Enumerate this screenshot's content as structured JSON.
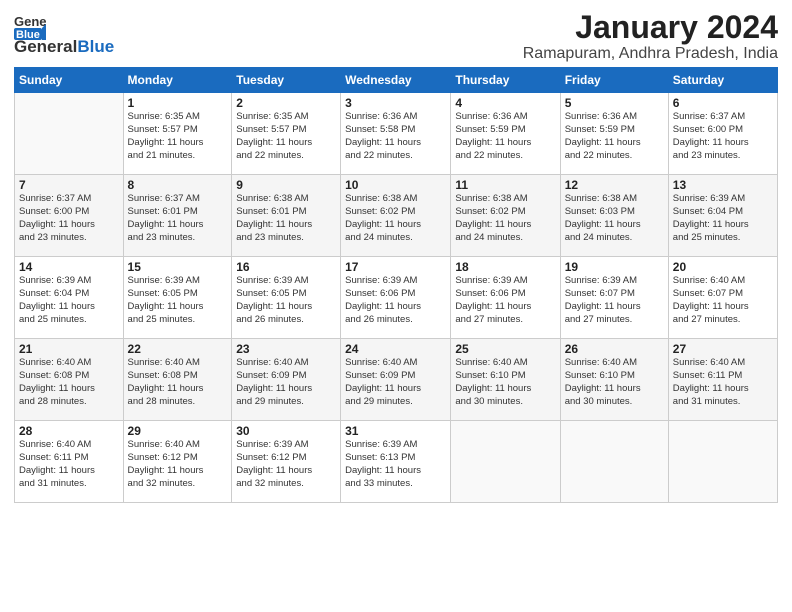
{
  "header": {
    "logo_general": "General",
    "logo_blue": "Blue",
    "month_title": "January 2024",
    "location": "Ramapuram, Andhra Pradesh, India"
  },
  "days_of_week": [
    "Sunday",
    "Monday",
    "Tuesday",
    "Wednesday",
    "Thursday",
    "Friday",
    "Saturday"
  ],
  "weeks": [
    [
      {
        "day": "",
        "info": ""
      },
      {
        "day": "1",
        "info": "Sunrise: 6:35 AM\nSunset: 5:57 PM\nDaylight: 11 hours\nand 21 minutes."
      },
      {
        "day": "2",
        "info": "Sunrise: 6:35 AM\nSunset: 5:57 PM\nDaylight: 11 hours\nand 22 minutes."
      },
      {
        "day": "3",
        "info": "Sunrise: 6:36 AM\nSunset: 5:58 PM\nDaylight: 11 hours\nand 22 minutes."
      },
      {
        "day": "4",
        "info": "Sunrise: 6:36 AM\nSunset: 5:59 PM\nDaylight: 11 hours\nand 22 minutes."
      },
      {
        "day": "5",
        "info": "Sunrise: 6:36 AM\nSunset: 5:59 PM\nDaylight: 11 hours\nand 22 minutes."
      },
      {
        "day": "6",
        "info": "Sunrise: 6:37 AM\nSunset: 6:00 PM\nDaylight: 11 hours\nand 23 minutes."
      }
    ],
    [
      {
        "day": "7",
        "info": "Sunrise: 6:37 AM\nSunset: 6:00 PM\nDaylight: 11 hours\nand 23 minutes."
      },
      {
        "day": "8",
        "info": "Sunrise: 6:37 AM\nSunset: 6:01 PM\nDaylight: 11 hours\nand 23 minutes."
      },
      {
        "day": "9",
        "info": "Sunrise: 6:38 AM\nSunset: 6:01 PM\nDaylight: 11 hours\nand 23 minutes."
      },
      {
        "day": "10",
        "info": "Sunrise: 6:38 AM\nSunset: 6:02 PM\nDaylight: 11 hours\nand 24 minutes."
      },
      {
        "day": "11",
        "info": "Sunrise: 6:38 AM\nSunset: 6:02 PM\nDaylight: 11 hours\nand 24 minutes."
      },
      {
        "day": "12",
        "info": "Sunrise: 6:38 AM\nSunset: 6:03 PM\nDaylight: 11 hours\nand 24 minutes."
      },
      {
        "day": "13",
        "info": "Sunrise: 6:39 AM\nSunset: 6:04 PM\nDaylight: 11 hours\nand 25 minutes."
      }
    ],
    [
      {
        "day": "14",
        "info": "Sunrise: 6:39 AM\nSunset: 6:04 PM\nDaylight: 11 hours\nand 25 minutes."
      },
      {
        "day": "15",
        "info": "Sunrise: 6:39 AM\nSunset: 6:05 PM\nDaylight: 11 hours\nand 25 minutes."
      },
      {
        "day": "16",
        "info": "Sunrise: 6:39 AM\nSunset: 6:05 PM\nDaylight: 11 hours\nand 26 minutes."
      },
      {
        "day": "17",
        "info": "Sunrise: 6:39 AM\nSunset: 6:06 PM\nDaylight: 11 hours\nand 26 minutes."
      },
      {
        "day": "18",
        "info": "Sunrise: 6:39 AM\nSunset: 6:06 PM\nDaylight: 11 hours\nand 27 minutes."
      },
      {
        "day": "19",
        "info": "Sunrise: 6:39 AM\nSunset: 6:07 PM\nDaylight: 11 hours\nand 27 minutes."
      },
      {
        "day": "20",
        "info": "Sunrise: 6:40 AM\nSunset: 6:07 PM\nDaylight: 11 hours\nand 27 minutes."
      }
    ],
    [
      {
        "day": "21",
        "info": "Sunrise: 6:40 AM\nSunset: 6:08 PM\nDaylight: 11 hours\nand 28 minutes."
      },
      {
        "day": "22",
        "info": "Sunrise: 6:40 AM\nSunset: 6:08 PM\nDaylight: 11 hours\nand 28 minutes."
      },
      {
        "day": "23",
        "info": "Sunrise: 6:40 AM\nSunset: 6:09 PM\nDaylight: 11 hours\nand 29 minutes."
      },
      {
        "day": "24",
        "info": "Sunrise: 6:40 AM\nSunset: 6:09 PM\nDaylight: 11 hours\nand 29 minutes."
      },
      {
        "day": "25",
        "info": "Sunrise: 6:40 AM\nSunset: 6:10 PM\nDaylight: 11 hours\nand 30 minutes."
      },
      {
        "day": "26",
        "info": "Sunrise: 6:40 AM\nSunset: 6:10 PM\nDaylight: 11 hours\nand 30 minutes."
      },
      {
        "day": "27",
        "info": "Sunrise: 6:40 AM\nSunset: 6:11 PM\nDaylight: 11 hours\nand 31 minutes."
      }
    ],
    [
      {
        "day": "28",
        "info": "Sunrise: 6:40 AM\nSunset: 6:11 PM\nDaylight: 11 hours\nand 31 minutes."
      },
      {
        "day": "29",
        "info": "Sunrise: 6:40 AM\nSunset: 6:12 PM\nDaylight: 11 hours\nand 32 minutes."
      },
      {
        "day": "30",
        "info": "Sunrise: 6:39 AM\nSunset: 6:12 PM\nDaylight: 11 hours\nand 32 minutes."
      },
      {
        "day": "31",
        "info": "Sunrise: 6:39 AM\nSunset: 6:13 PM\nDaylight: 11 hours\nand 33 minutes."
      },
      {
        "day": "",
        "info": ""
      },
      {
        "day": "",
        "info": ""
      },
      {
        "day": "",
        "info": ""
      }
    ]
  ]
}
